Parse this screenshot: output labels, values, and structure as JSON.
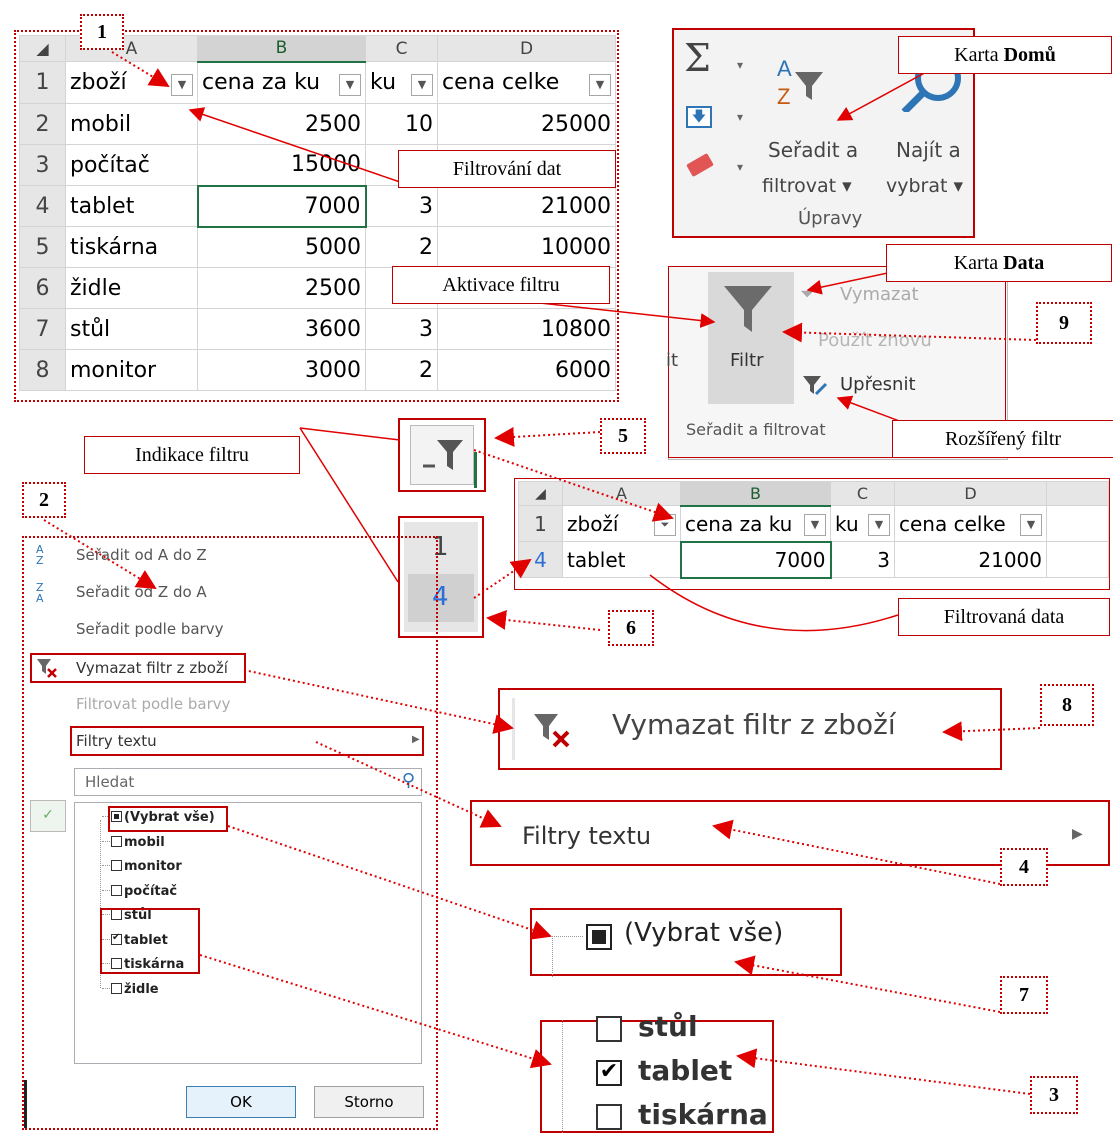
{
  "colors": {
    "accent": "#c00000",
    "excel_green": "#217346"
  },
  "sheet1": {
    "columns": [
      "A",
      "B",
      "C",
      "D"
    ],
    "header": [
      "zboží",
      "cena za ku",
      "ku",
      "cena celke"
    ],
    "rows": [
      {
        "n": "2",
        "a": "mobil",
        "b": "2500",
        "c": "10",
        "d": "25000"
      },
      {
        "n": "3",
        "a": "počítač",
        "b": "15000",
        "c": "",
        "d": ""
      },
      {
        "n": "4",
        "a": "tablet",
        "b": "7000",
        "c": "3",
        "d": "21000"
      },
      {
        "n": "5",
        "a": "tiskárna",
        "b": "5000",
        "c": "2",
        "d": "10000"
      },
      {
        "n": "6",
        "a": "židle",
        "b": "2500",
        "c": "",
        "d": ""
      },
      {
        "n": "7",
        "a": "stůl",
        "b": "3600",
        "c": "3",
        "d": "10800"
      },
      {
        "n": "8",
        "a": "monitor",
        "b": "3000",
        "c": "2",
        "d": "6000"
      }
    ],
    "row1": "1"
  },
  "ribbon_home": {
    "button_line1": "Seřadit a",
    "button_line2": "filtrovat ▾",
    "find_line1": "Najít a",
    "find_line2": "vybrat ▾",
    "group": "Úpravy",
    "sigma": "Σ"
  },
  "ribbon_data": {
    "filter": "Filtr",
    "clear": "Vymazat",
    "reapply": "Použít znovu",
    "advanced": "Upřesnit",
    "group": "Seřadit a filtrovat",
    "side_letter": "it"
  },
  "callouts": {
    "karta_domu_prefix": "Karta ",
    "karta_domu_bold": "Domů",
    "karta_data_prefix": "Karta ",
    "karta_data_bold": "Data",
    "filtrovani": "Filtrování dat",
    "aktivace": "Aktivace filtru",
    "rozsireny": "Rozšířený filtr",
    "indikace": "Indikace filtru",
    "filtrovana": "Filtrovaná data"
  },
  "numbers": {
    "n1": "1",
    "n2": "2",
    "n3": "3",
    "n4": "4",
    "n5": "5",
    "n6": "6",
    "n7": "7",
    "n8": "8",
    "n9": "9"
  },
  "sheet2": {
    "columns": [
      "A",
      "B",
      "C",
      "D"
    ],
    "header": [
      "zboží",
      "cena za ku",
      "ku",
      "cena celke"
    ],
    "row": {
      "n": "4",
      "a": "tablet",
      "b": "7000",
      "c": "3",
      "d": "21000"
    },
    "row1": "1"
  },
  "row_indicator": {
    "r1": "1",
    "r4": "4"
  },
  "menu": {
    "sort_az": "Seřadit od A do Z",
    "sort_za": "Seřadit od Z do A",
    "sort_color": "Seřadit podle barvy",
    "clear_filter": "Vymazat filtr z zboží",
    "filter_color": "Filtrovat podle barvy",
    "text_filters": "Filtry textu",
    "search_placeholder": "Hledat",
    "items": [
      "(Vybrat vše)",
      "mobil",
      "monitor",
      "počítač",
      "stůl",
      "tablet",
      "tiskárna",
      "židle"
    ],
    "ok": "OK",
    "cancel": "Storno"
  },
  "zoom": {
    "clear_filter": "Vymazat filtr z zboží",
    "text_filters": "Filtry textu",
    "select_all": "(Vybrat vše)",
    "stul": "stůl",
    "tablet": "tablet",
    "tiskarna": "tiskárna"
  }
}
